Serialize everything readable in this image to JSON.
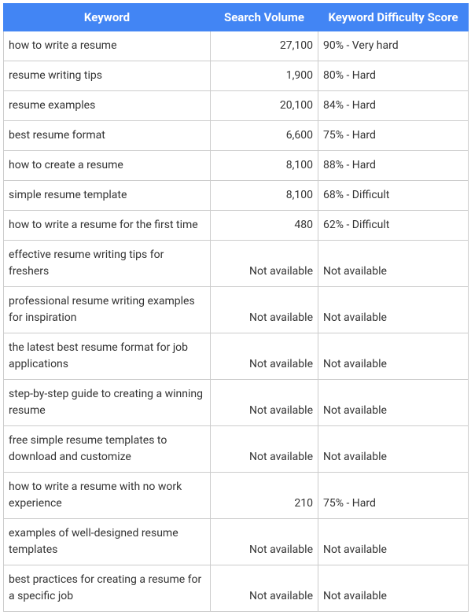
{
  "headers": {
    "keyword": "Keyword",
    "volume": "Search Volume",
    "difficulty": "Keyword Difficulty Score"
  },
  "rows": [
    {
      "keyword": "how to write a resume",
      "volume": "27,100",
      "difficulty": "90% - Very hard"
    },
    {
      "keyword": "resume writing tips",
      "volume": "1,900",
      "difficulty": "80% - Hard"
    },
    {
      "keyword": "resume examples",
      "volume": "20,100",
      "difficulty": "84% - Hard"
    },
    {
      "keyword": "best resume format",
      "volume": "6,600",
      "difficulty": "75% - Hard"
    },
    {
      "keyword": "how to create a resume",
      "volume": "8,100",
      "difficulty": "88% - Hard"
    },
    {
      "keyword": "simple resume template",
      "volume": "8,100",
      "difficulty": "68% - Difficult"
    },
    {
      "keyword": "how to write a resume for the first time",
      "volume": "480",
      "difficulty": "62% - Difficult"
    },
    {
      "keyword": "effective resume writing tips for freshers",
      "volume": "Not available",
      "difficulty": "Not available"
    },
    {
      "keyword": "professional resume writing examples for inspiration",
      "volume": "Not available",
      "difficulty": "Not available"
    },
    {
      "keyword": "the latest best resume format for job applications",
      "volume": "Not available",
      "difficulty": "Not available"
    },
    {
      "keyword": "step-by-step guide to creating a winning resume",
      "volume": "Not available",
      "difficulty": "Not available"
    },
    {
      "keyword": "free simple resume templates to download and customize",
      "volume": "Not available",
      "difficulty": "Not available"
    },
    {
      "keyword": "how to write a resume with no work experience",
      "volume": "210",
      "difficulty": "75% - Hard"
    },
    {
      "keyword": "examples of well-designed resume templates",
      "volume": "Not available",
      "difficulty": "Not available"
    },
    {
      "keyword": "best practices for creating a resume for a specific job",
      "volume": "Not available",
      "difficulty": "Not available"
    }
  ]
}
